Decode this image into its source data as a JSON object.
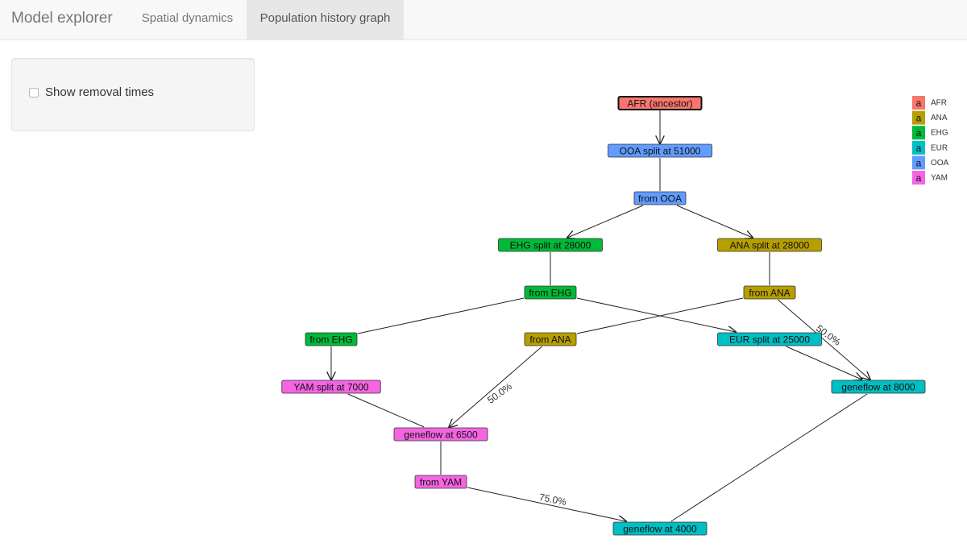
{
  "navbar": {
    "brand": "Model explorer",
    "tabs": [
      {
        "label": "Spatial dynamics",
        "active": false
      },
      {
        "label": "Population history graph",
        "active": true
      }
    ]
  },
  "sidebar": {
    "checkbox_label": "Show removal times",
    "checkbox_checked": false
  },
  "graph": {
    "colors": {
      "AFR": "#f8766d",
      "ANA": "#b79f00",
      "EHG": "#00ba38",
      "EUR": "#00bfc4",
      "OOA": "#619cff",
      "YAM": "#f564e3"
    },
    "nodes": [
      {
        "id": "afr",
        "label": "AFR (ancestor)",
        "pop": "AFR",
        "root": true
      },
      {
        "id": "ooa_split",
        "label": "OOA split at 51000",
        "pop": "OOA"
      },
      {
        "id": "from_ooa",
        "label": "from OOA",
        "pop": "OOA"
      },
      {
        "id": "ehg_split",
        "label": "EHG split at 28000",
        "pop": "EHG"
      },
      {
        "id": "ana_split",
        "label": "ANA split at 28000",
        "pop": "ANA"
      },
      {
        "id": "from_ehg_1",
        "label": "from EHG",
        "pop": "EHG"
      },
      {
        "id": "from_ana_1",
        "label": "from ANA",
        "pop": "ANA"
      },
      {
        "id": "from_ehg_2",
        "label": "from EHG",
        "pop": "EHG"
      },
      {
        "id": "from_ana_2",
        "label": "from ANA",
        "pop": "ANA"
      },
      {
        "id": "eur_split",
        "label": "EUR split at 25000",
        "pop": "EUR"
      },
      {
        "id": "yam_split",
        "label": "YAM split at 7000",
        "pop": "YAM"
      },
      {
        "id": "gf_8000",
        "label": "geneflow at 8000",
        "pop": "EUR"
      },
      {
        "id": "gf_6500",
        "label": "geneflow at 6500",
        "pop": "YAM"
      },
      {
        "id": "from_yam",
        "label": "from YAM",
        "pop": "YAM"
      },
      {
        "id": "gf_4000",
        "label": "geneflow at 4000",
        "pop": "EUR"
      }
    ],
    "edges": [
      {
        "from": "afr",
        "to": "ooa_split",
        "arrow": true
      },
      {
        "from": "ooa_split",
        "to": "from_ooa",
        "arrow": false
      },
      {
        "from": "from_ooa",
        "to": "ehg_split",
        "arrow": true
      },
      {
        "from": "from_ooa",
        "to": "ana_split",
        "arrow": true
      },
      {
        "from": "ehg_split",
        "to": "from_ehg_1",
        "arrow": false
      },
      {
        "from": "ana_split",
        "to": "from_ana_1",
        "arrow": false
      },
      {
        "from": "from_ehg_1",
        "to": "from_ehg_2",
        "arrow": false
      },
      {
        "from": "from_ehg_1",
        "to": "eur_split",
        "arrow": true
      },
      {
        "from": "from_ana_1",
        "to": "from_ana_2",
        "arrow": false
      },
      {
        "from": "from_ana_1",
        "to": "gf_8000",
        "arrow": true,
        "label": "50.0%"
      },
      {
        "from": "from_ehg_2",
        "to": "yam_split",
        "arrow": true
      },
      {
        "from": "eur_split",
        "to": "gf_8000",
        "arrow": true
      },
      {
        "from": "from_ana_2",
        "to": "gf_6500",
        "arrow": true,
        "label": "50.0%"
      },
      {
        "from": "yam_split",
        "to": "gf_6500",
        "arrow": false
      },
      {
        "from": "gf_6500",
        "to": "from_yam",
        "arrow": false
      },
      {
        "from": "from_yam",
        "to": "gf_4000",
        "arrow": true,
        "label": "75.0%"
      },
      {
        "from": "gf_8000",
        "to": "gf_4000",
        "arrow": false
      }
    ],
    "legend": {
      "key_glyph": "a",
      "items": [
        "AFR",
        "ANA",
        "EHG",
        "EUR",
        "OOA",
        "YAM"
      ]
    }
  }
}
